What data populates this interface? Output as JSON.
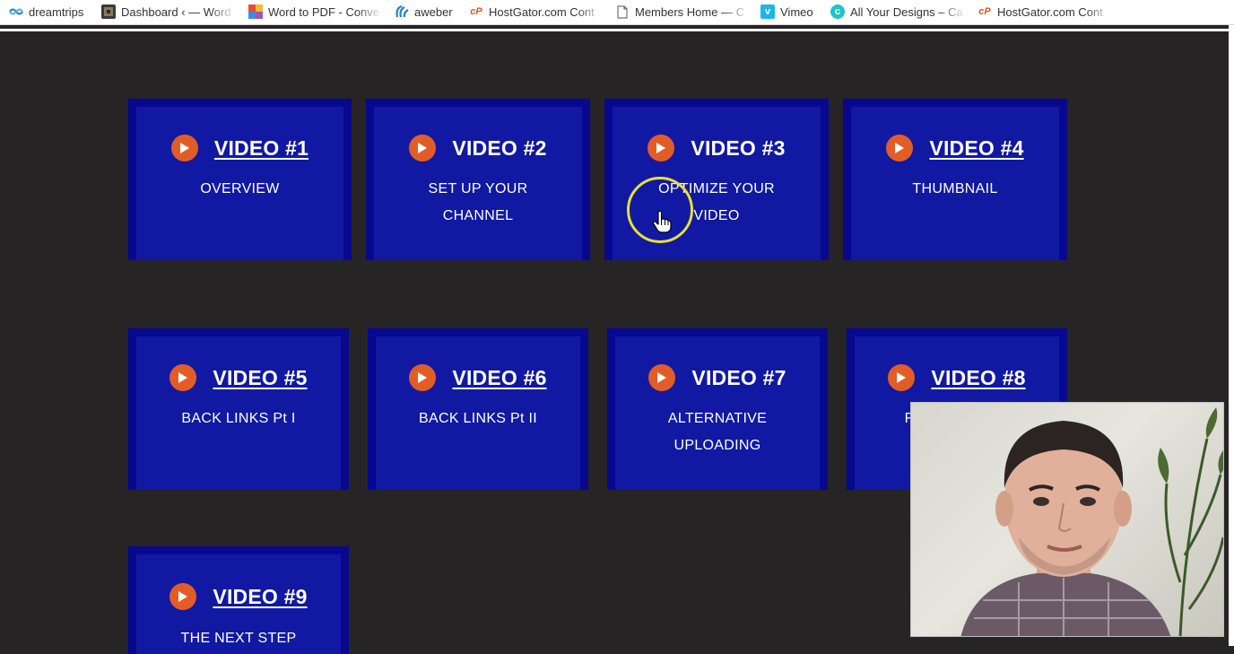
{
  "bookmarks": [
    {
      "label": "dreamtrips",
      "icon": "dreamtrips-icon"
    },
    {
      "label": "Dashboard ‹ — Word",
      "icon": "dashboard-icon"
    },
    {
      "label": "Word to PDF - Conve",
      "icon": "word-to-pdf-icon"
    },
    {
      "label": "aweber",
      "icon": "aweber-icon"
    },
    {
      "label": "HostGator.com Cont",
      "icon": "cpanel-icon"
    },
    {
      "label": "Members Home — C",
      "icon": "document-icon"
    },
    {
      "label": "Vimeo",
      "icon": "vimeo-icon"
    },
    {
      "label": "All Your Designs – Ca",
      "icon": "canva-icon"
    },
    {
      "label": "HostGator.com Cont",
      "icon": "cpanel-icon"
    }
  ],
  "videos": [
    {
      "title": "VIDEO #1",
      "desc1": "OVERVIEW",
      "desc2": ""
    },
    {
      "title": "VIDEO #2",
      "desc1": "SET UP YOUR",
      "desc2": "CHANNEL"
    },
    {
      "title": "VIDEO #3",
      "desc1": "OPTIMIZE YOUR",
      "desc2": "VIDEO"
    },
    {
      "title": "VIDEO #4",
      "desc1": "THUMBNAIL",
      "desc2": ""
    },
    {
      "title": "VIDEO #5",
      "desc1": "BACK LINKS Pt I",
      "desc2": ""
    },
    {
      "title": "VIDEO #6",
      "desc1": "BACK LINKS Pt II",
      "desc2": ""
    },
    {
      "title": "VIDEO #7",
      "desc1": "ALTERNATIVE",
      "desc2": "UPLOADING"
    },
    {
      "title": "VIDEO #8",
      "desc1": "FIN",
      "desc2": ""
    },
    {
      "title": "VIDEO #9",
      "desc1": "THE NEXT STEP",
      "desc2": ""
    }
  ],
  "colors": {
    "page_background": "#262424",
    "card_border": "#07088e",
    "card_fill": "#1119a2",
    "play_button": "#e25d26",
    "cursor_highlight": "#e7df38"
  }
}
